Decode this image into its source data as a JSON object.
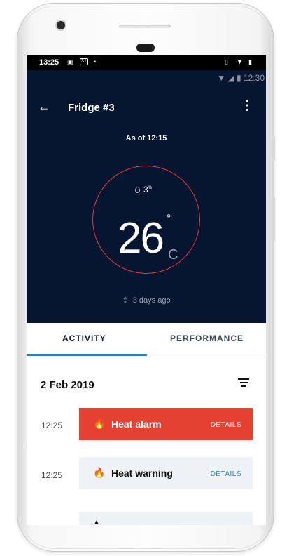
{
  "device_status": {
    "time": "13:25",
    "icons": [
      "image-icon",
      "calendar-icon",
      "dot-icon"
    ],
    "right_icons": [
      "vibrate-icon",
      "wifi-icon",
      "battery-icon"
    ]
  },
  "app_status": {
    "time": "12:30"
  },
  "toolbar": {
    "title": "Fridge #3"
  },
  "reading": {
    "as_of": "As of 12:15",
    "humidity": "3",
    "humidity_unit": "%",
    "temperature": "26",
    "degree": "°",
    "unit": "C",
    "uploaded": "3 days ago"
  },
  "tabs": [
    {
      "label": "ACTIVITY"
    },
    {
      "label": "PERFORMANCE"
    }
  ],
  "activity": {
    "date": "2 Feb 2019",
    "items": [
      {
        "time": "12:25",
        "label": "Heat alarm",
        "details": "DETAILS"
      },
      {
        "time": "12:25",
        "label": "Heat warning",
        "details": "DETAILS"
      }
    ]
  },
  "colors": {
    "dark_bg": "#061630",
    "alarm": "#e44133",
    "accent": "#2f7fc0",
    "ring": "#e2393a"
  }
}
